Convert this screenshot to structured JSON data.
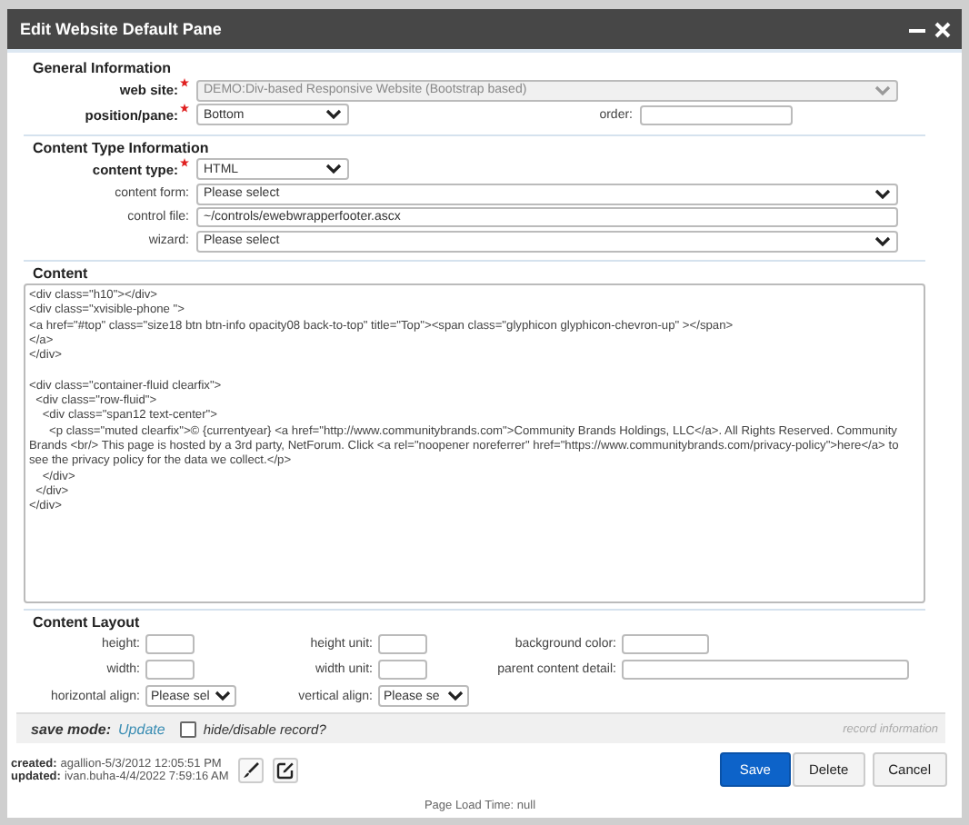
{
  "window": {
    "title": "Edit Website Default Pane"
  },
  "sections": [
    {
      "title": "General Information",
      "rows": [
        [
          {
            "label": "web site:",
            "required": true,
            "kind": "wide_select",
            "value": "DEMO:Div-based Responsive Website (Bootstrap based)",
            "disabled": true
          }
        ],
        [
          {
            "label": "position/pane:",
            "required": true,
            "kind": "select",
            "value": "Bottom",
            "disabled": false
          },
          {
            "label": "order:",
            "required": false,
            "kind": "input",
            "disabled": false
          }
        ]
      ]
    },
    {
      "title": "Content Type Information",
      "rows": [
        [
          {
            "label": "content type:",
            "required": true,
            "kind": "select",
            "value": "HTML",
            "disabled": false
          }
        ],
        [
          {
            "label": "content form:",
            "required": false,
            "kind": "wide_select",
            "value": "Please select",
            "disabled": false
          }
        ],
        [
          {
            "label": "control file:",
            "required": false,
            "kind": "wide_input",
            "value": "~/controls/ewebwrapperfooter.ascx",
            "disabled": false
          }
        ],
        [
          {
            "label": "wizard:",
            "required": false,
            "kind": "wide_select",
            "value": "Please select",
            "disabled": false
          }
        ]
      ]
    }
  ],
  "content": {
    "title": "Content",
    "value": "<div class=\"h10\"></div>\n<div class=\"xvisible-phone \">\n<a href=\"#top\" class=\"size18 btn btn-info opacity08 back-to-top\" title=\"Top\"><span class=\"glyphicon glyphicon-chevron-up\" ></span>\n</a>\n</div>\n\n<div class=\"container-fluid clearfix\">\n  <div class=\"row-fluid\">\n    <div class=\"span12 text-center\">\n      <p class=\"muted clearfix\">© {currentyear} <a href=\"http://www.communitybrands.com\">Community Brands Holdings, LLC</a>. All Rights Reserved. Community Brands <br/> This page is hosted by a 3rd party, NetForum. Click <a rel=\"noopener noreferrer\" href=\"https://www.communitybrands.com/privacy-policy\">here</a> to see the privacy policy for the data we collect.</p>\n    </div>\n  </div>\n</div>"
  },
  "layout": {
    "title": "Content Layout",
    "rows": [
      [
        {
          "label": "height:",
          "kind": "input"
        },
        {
          "label": "height unit:",
          "kind": "input"
        },
        {
          "label": "background color:",
          "kind": "input"
        }
      ],
      [
        {
          "label": "width:",
          "kind": "input"
        },
        {
          "label": "width unit:",
          "kind": "input"
        },
        {
          "label": "parent content detail:",
          "kind": "wide_input"
        }
      ],
      [
        {
          "label": "horizontal align:",
          "kind": "select",
          "value": "Please sel"
        },
        {
          "label": "vertical align:",
          "kind": "select",
          "value": "Please se"
        }
      ]
    ]
  },
  "save_bar": {
    "label": "save mode:",
    "mode": "Update",
    "checkbox": {
      "label": "hide/disable record?",
      "checked": false
    },
    "record_info": "record information"
  },
  "audit": [
    {
      "label": "created:",
      "value": "agallion-5/3/2012 12:05:51 PM"
    },
    {
      "label": "updated:",
      "value": "ivan.buha-4/4/2022 7:59:16 AM"
    }
  ],
  "buttons": [
    {
      "label": "Save",
      "primary": true
    },
    {
      "label": "Delete",
      "primary": false
    },
    {
      "label": "Cancel",
      "primary": false
    }
  ],
  "footer": "Page Load Time: null"
}
